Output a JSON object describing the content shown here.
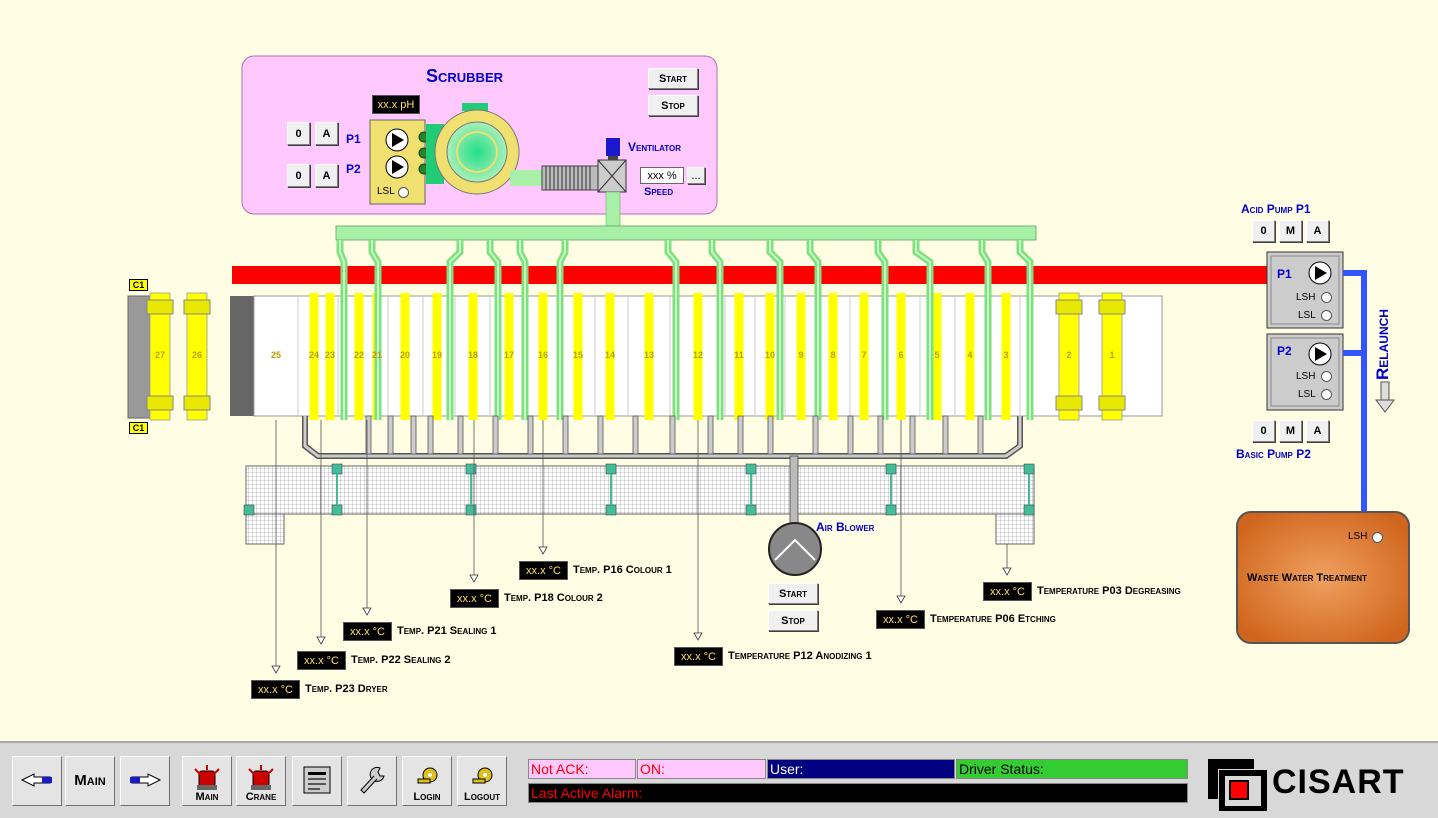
{
  "scrubber": {
    "title": "Scrubber",
    "start_label": "Start",
    "stop_label": "Stop",
    "ph_display": "xx.x pH",
    "p1_label": "P1",
    "p2_label": "P2",
    "btn_o": "0",
    "btn_a": "A",
    "lsl_label": "LSL",
    "ventilator_label": "Ventilator",
    "speed_display": "xxx %",
    "speed_btn": "...",
    "speed_label": "Speed"
  },
  "acid_pump": {
    "title": "Acid Pump P1",
    "p_label": "P1",
    "lsh_label": "LSH",
    "lsl_label": "LSL",
    "buttons": [
      "0",
      "M",
      "A"
    ]
  },
  "basic_pump": {
    "title": "Basic Pump P2",
    "p_label": "P2",
    "lsh_label": "LSH",
    "lsl_label": "LSL",
    "buttons": [
      "0",
      "M",
      "A"
    ]
  },
  "relaunch_label": "Relaunch",
  "waste_water": {
    "title": "Waste Water Treatment",
    "lsh_label": "LSH"
  },
  "air_blower": {
    "label": "Air Blower",
    "start_label": "Start",
    "stop_label": "Stop"
  },
  "crane_labels": [
    "C1",
    "C1"
  ],
  "tanks": [
    "27",
    "26",
    "25",
    "24",
    "23",
    "22",
    "21",
    "20",
    "19",
    "18",
    "17",
    "16",
    "15",
    "14",
    "13",
    "12",
    "11",
    "10",
    "9",
    "8",
    "7",
    "6",
    "5",
    "4",
    "3",
    "2",
    "1"
  ],
  "temperatures": [
    {
      "value": "xx.x °C",
      "label": "Temp. P16 Colour 1"
    },
    {
      "value": "xx.x °C",
      "label": "Temp. P18 Colour 2"
    },
    {
      "value": "xx.x °C",
      "label": "Temp. P21 Sealing 1"
    },
    {
      "value": "xx.x °C",
      "label": "Temp. P22 Sealing 2"
    },
    {
      "value": "xx.x °C",
      "label": "Temp. P23 Dryer"
    },
    {
      "value": "xx.x °C",
      "label": "Temperature P12 Anodizing 1"
    },
    {
      "value": "xx.x °C",
      "label": "Temperature P06 Etching"
    },
    {
      "value": "xx.x °C",
      "label": "Temperature P03 Degreasing"
    }
  ],
  "taskbar": {
    "main_label": "Main",
    "alarm_main_label": "Main",
    "crane_label": "Crane",
    "login_label": "Login",
    "logout_label": "Logout",
    "not_ack_label": "Not ACK:",
    "on_label": "ON:",
    "user_label": "User:",
    "driver_status_label": "Driver Status:",
    "last_alarm_label": "Last Active Alarm:",
    "logo_text": "CISART"
  },
  "colors": {
    "background": "#fffde3",
    "scrubber_panel": "#ffc8ff",
    "pipe_green": "#7ee07e",
    "exhaust_red": "#ff0000",
    "tank_yellow": "#ffff00",
    "relaunch_blue": "#3355ff",
    "waste_tank": "#d9742e",
    "not_ack_bg": "#ffc8ff",
    "user_bg": "#000080",
    "driver_bg": "#33cc33"
  }
}
